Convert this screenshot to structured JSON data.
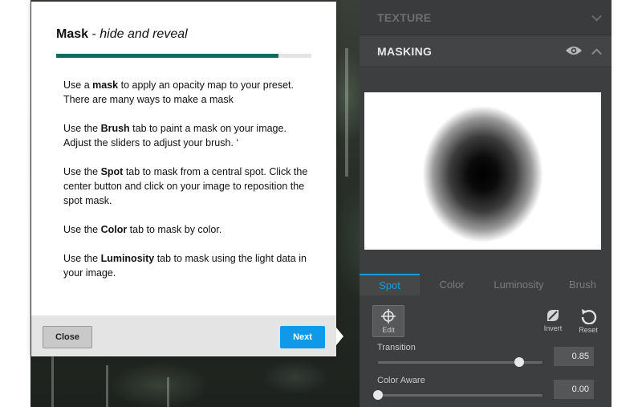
{
  "dialog": {
    "title_main": "Mask",
    "title_separator": " - ",
    "title_sub": "hide and reveal",
    "progress": 0.87,
    "paragraphs": [
      {
        "before": "Use a ",
        "bold": "mask",
        "after": " to apply an opacity map to your preset. There are many ways to make a mask"
      },
      {
        "before": "Use the ",
        "bold": "Brush",
        "after": " tab to paint a mask on your image. Adjust the sliders to adjust your brush. ‘"
      },
      {
        "before": "Use the ",
        "bold": "Spot",
        "after": " tab to mask from a central spot. Click the center button and click on your image to reposition the spot mask."
      },
      {
        "before": "Use the ",
        "bold": "Color",
        "after": " tab to mask by color."
      },
      {
        "before": "Use the ",
        "bold": "Luminosity",
        "after": " tab to mask using the light data in your image."
      }
    ],
    "close_label": "Close",
    "next_label": "Next"
  },
  "panel": {
    "texture_label": "TEXTURE",
    "masking_label": "MASKING",
    "tabs": [
      {
        "label": "Spot",
        "active": true
      },
      {
        "label": "Color",
        "active": false
      },
      {
        "label": "Luminosity",
        "active": false
      },
      {
        "label": "Brush",
        "active": false
      }
    ],
    "tools": {
      "edit_label": "Edit",
      "invert_label": "Invert",
      "reset_label": "Reset"
    },
    "sliders": [
      {
        "label": "Transition",
        "value": "0.85",
        "fraction": 0.86
      },
      {
        "label": "Color Aware",
        "value": "0.00",
        "fraction": 0.0
      }
    ]
  },
  "colors": {
    "accent": "#1e9bd7",
    "progress": "#0c6b62",
    "next_button": "#0f99e8",
    "panel_bg": "#3d3e3f"
  },
  "icons": {
    "texture_chevron": "chevron-down-icon",
    "masking_eye": "eye-icon",
    "masking_chevron": "chevron-up-icon",
    "edit": "crosshair-icon",
    "invert": "invert-icon",
    "reset": "reset-icon"
  }
}
